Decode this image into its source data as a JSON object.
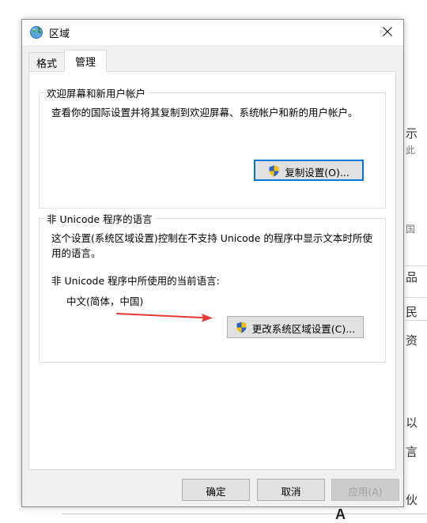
{
  "dialog": {
    "title": "区域",
    "tabs": [
      {
        "label": "格式"
      },
      {
        "label": "管理"
      }
    ],
    "welcome_group": {
      "legend": "欢迎屏幕和新用户帐户",
      "description": "查看你的国际设置并将其复制到欢迎屏幕、系统帐户和新的用户帐户。",
      "copy_button": "复制设置(O)..."
    },
    "non_unicode_group": {
      "legend": "非 Unicode 程序的语言",
      "description_line1": "这个设置(系统区域设置)控制在不支持 Unicode 的程序中显示文本时所使",
      "description_line2": "用的语言。",
      "current_label": "非 Unicode 程序中所使用的当前语言:",
      "current_value": "中文(简体，中国)",
      "change_button": "更改系统区域设置(C)..."
    },
    "footer": {
      "ok": "确定",
      "cancel": "取消",
      "apply": "应用(A)"
    }
  },
  "annotation": {
    "arrow_color": "#e53935"
  },
  "background_window": {
    "fragments": [
      "示",
      "此",
      "国",
      "品",
      "民",
      "资",
      "以",
      "言",
      "伙"
    ],
    "bottom_letter": "A"
  },
  "colors": {
    "accent": "#0078d7",
    "dialog_bg": "#f0f0f0",
    "panel_bg": "#ffffff"
  },
  "icons": {
    "title": "globe-icon",
    "close": "close-icon",
    "uac": "uac-shield-icon"
  }
}
